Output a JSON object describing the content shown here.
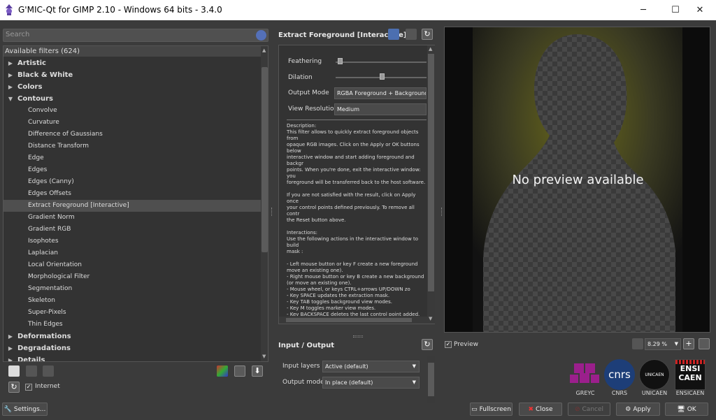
{
  "window": {
    "title": "G'MIC-Qt for GIMP 2.10 - Windows 64 bits - 3.4.0"
  },
  "search": {
    "placeholder": "Search"
  },
  "tree": {
    "header": "Available filters (624)",
    "items": [
      {
        "label": "Artistic",
        "type": "cat",
        "open": false
      },
      {
        "label": "Black & White",
        "type": "cat",
        "open": false
      },
      {
        "label": "Colors",
        "type": "cat",
        "open": false
      },
      {
        "label": "Contours",
        "type": "cat",
        "open": true
      },
      {
        "label": "Convolve",
        "type": "leaf"
      },
      {
        "label": "Curvature",
        "type": "leaf"
      },
      {
        "label": "Difference of Gaussians",
        "type": "leaf"
      },
      {
        "label": "Distance Transform",
        "type": "leaf"
      },
      {
        "label": "Edge",
        "type": "leaf"
      },
      {
        "label": "Edges",
        "type": "leaf"
      },
      {
        "label": "Edges (Canny)",
        "type": "leaf"
      },
      {
        "label": "Edges Offsets",
        "type": "leaf"
      },
      {
        "label": "Extract Foreground [Interactive]",
        "type": "leaf",
        "selected": true
      },
      {
        "label": "Gradient Norm",
        "type": "leaf"
      },
      {
        "label": "Gradient RGB",
        "type": "leaf"
      },
      {
        "label": "Isophotes",
        "type": "leaf"
      },
      {
        "label": "Laplacian",
        "type": "leaf"
      },
      {
        "label": "Local Orientation",
        "type": "leaf"
      },
      {
        "label": "Morphological Filter",
        "type": "leaf"
      },
      {
        "label": "Segmentation",
        "type": "leaf"
      },
      {
        "label": "Skeleton",
        "type": "leaf"
      },
      {
        "label": "Super-Pixels",
        "type": "leaf"
      },
      {
        "label": "Thin Edges",
        "type": "leaf"
      },
      {
        "label": "Deformations",
        "type": "cat",
        "open": false
      },
      {
        "label": "Degradations",
        "type": "cat",
        "open": false
      },
      {
        "label": "Details",
        "type": "cat",
        "open": false
      }
    ]
  },
  "internet": {
    "label": "Internet",
    "checked": true
  },
  "settings": {
    "label": "Settings..."
  },
  "filter": {
    "title": "Extract Foreground [Interactive]",
    "params": [
      {
        "label": "Feathering",
        "value": 0.05
      },
      {
        "label": "Dilation",
        "value": 0.52
      }
    ],
    "output_mode": {
      "label": "Output Mode",
      "value": "RGBA Foreground + Background"
    },
    "view_resolution": {
      "label": "View Resolution",
      "value": "Medium"
    },
    "description": "Description:\nThis filter allows to quickly extract foreground objects from\nopaque RGB images. Click on the Apply or OK buttons below\ninteractive window and start adding foreground and backgr\npoints. When you're done, exit the interactive window: you\nforeground will be transferred back to the host software.\n\nIf you are not satisfied with the result, click on Apply once\nyour control points defined previously. To remove all contr\nthe Reset button above.\n\nInteractions:\nUse the following actions in the interactive window to build\nmask :\n\n- Left mouse button or key F create a new foreground\nmove an existing one).\n- Right mouse button or key B create a new background\n(or move an existing one).\n- Mouse wheel, or keys CTRL+arrows UP/DOWN zo\n- Key SPACE updates the extraction mask.\n- Key TAB toggles background view modes.\n- Key M toggles marker view modes.\n- Key BACKSPACE deletes the last control point added.\n- Key PAGE UP increases background opacity.\n- Key PAGE DOWN decreases background opacity.\n- Keys CTRL+D increase window size.\n- Keys CTRL+C decrease window size.\n- Keys CTRL+R reset window size.\n- Keys ESC, Q or ENTER exit the interactive window."
  },
  "io": {
    "title": "Input / Output",
    "input_layers": {
      "label": "Input layers",
      "value": "Active (default)"
    },
    "output_mode": {
      "label": "Output mode",
      "value": "In place (default)"
    }
  },
  "preview": {
    "message": "No preview available",
    "checkbox_label": "Preview",
    "checked": true,
    "zoom": "8.29 %"
  },
  "logos": [
    {
      "name": "GREYC",
      "color": "#9b1f8c"
    },
    {
      "name": "CNRS",
      "color": "#1d3e78"
    },
    {
      "name": "UNICAEN",
      "color": "#111111"
    },
    {
      "name": "ENSICAEN",
      "color": "#111111"
    }
  ],
  "logo_marks": {
    "cnrs": "cnrs",
    "unicaen": "UNICAEN",
    "ensicaen_top": "ENSI",
    "ensicaen_bottom": "CAEN"
  },
  "buttons": {
    "fullscreen": "Fullscreen",
    "close": "Close",
    "cancel": "Cancel",
    "apply": "Apply",
    "ok": "OK"
  }
}
